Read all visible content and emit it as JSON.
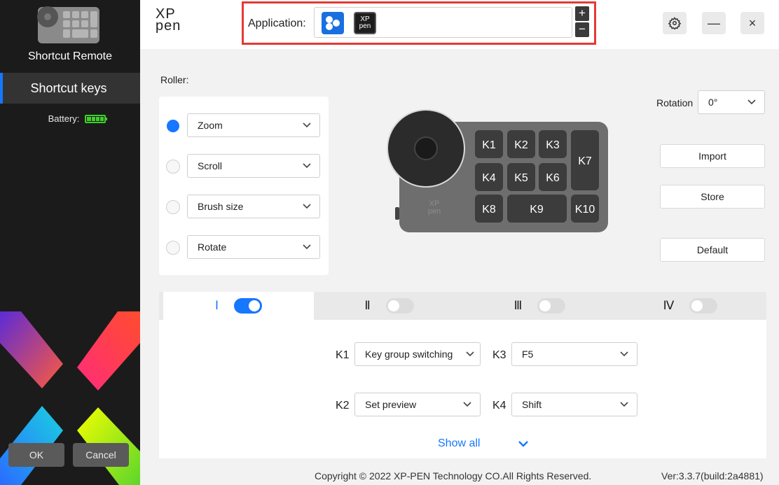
{
  "sidebar": {
    "device_name": "Shortcut Remote",
    "nav_item": "Shortcut keys",
    "battery_label": "Battery:",
    "battery_level": 1.0,
    "ok_label": "OK",
    "cancel_label": "Cancel"
  },
  "header": {
    "logo_top": "XP",
    "logo_bottom": "pen",
    "application_label": "Application:",
    "app_icons": [
      "photos-app-icon",
      "xppen-app-icon"
    ],
    "add_symbol": "+",
    "remove_symbol": "−",
    "minimize_symbol": "—",
    "close_symbol": "×",
    "highlight_color": "#e53935"
  },
  "roller": {
    "label": "Roller:",
    "options": [
      {
        "value": "Zoom",
        "selected": true
      },
      {
        "value": "Scroll",
        "selected": false
      },
      {
        "value": "Brush size",
        "selected": false
      },
      {
        "value": "Rotate",
        "selected": false
      }
    ]
  },
  "device": {
    "keys": [
      "K1",
      "K2",
      "K3",
      "K4",
      "K5",
      "K6",
      "K7",
      "K8",
      "K9",
      "K10"
    ],
    "brand_top": "XP",
    "brand_bottom": "pen"
  },
  "rotation": {
    "label": "Rotation",
    "value": "0°"
  },
  "actions": {
    "import": "Import",
    "store": "Store",
    "default": "Default"
  },
  "tabs": [
    {
      "label": "Ⅰ",
      "enabled": true,
      "active": true
    },
    {
      "label": "Ⅱ",
      "enabled": false,
      "active": false
    },
    {
      "label": "Ⅲ",
      "enabled": false,
      "active": false
    },
    {
      "label": "Ⅳ",
      "enabled": false,
      "active": false
    }
  ],
  "key_mappings": [
    {
      "key": "K1",
      "value": "Key group switching"
    },
    {
      "key": "K3",
      "value": "F5"
    },
    {
      "key": "K2",
      "value": "Set preview"
    },
    {
      "key": "K4",
      "value": "Shift"
    }
  ],
  "show_all": "Show all",
  "footer": {
    "copyright": "Copyright © 2022  XP-PEN Technology CO.All Rights Reserved.",
    "version": "Ver:3.3.7(build:2a4881)"
  },
  "colors": {
    "accent": "#1677ff",
    "battery": "#3ecf2b",
    "sidebar_bg": "#1b1b1b"
  }
}
